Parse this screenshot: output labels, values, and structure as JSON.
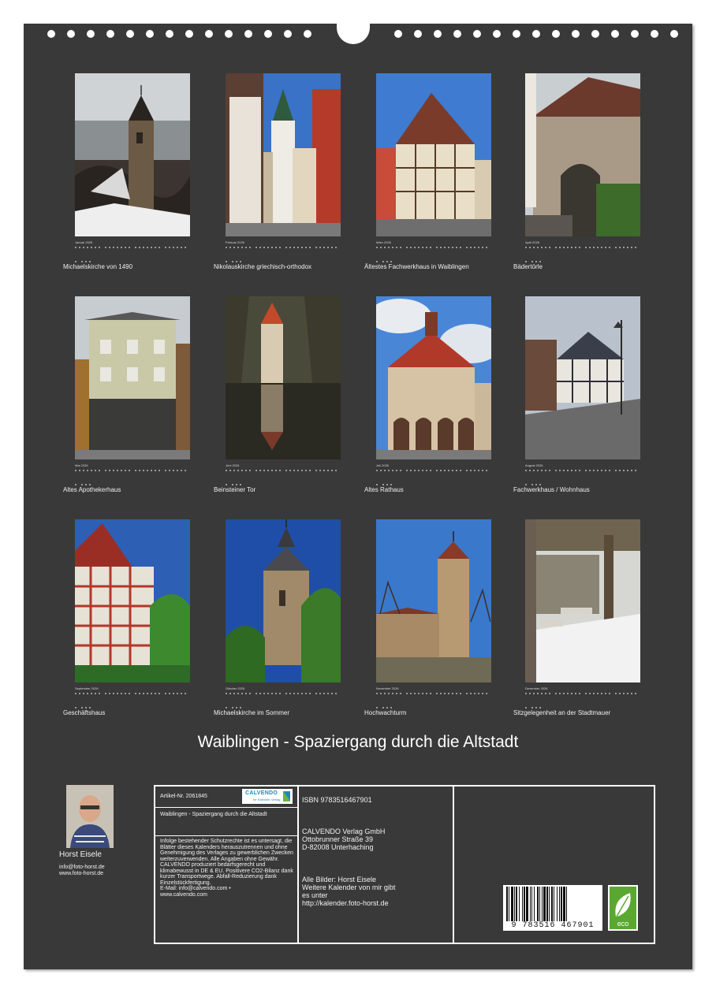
{
  "months": [
    {
      "month": "Januar 2026",
      "caption": "Michaelskirche von 1490"
    },
    {
      "month": "Februar 2026",
      "caption": "Nikolauskirche griechisch-orthodox"
    },
    {
      "month": "März 2026",
      "caption": "Ältestes Fachwerkhaus in Waiblingen"
    },
    {
      "month": "April 2026",
      "caption": "Bädertörle"
    },
    {
      "month": "Mai 2026",
      "caption": "Altes Apothekerhaus"
    },
    {
      "month": "Juni 2026",
      "caption": "Beinsteiner Tor"
    },
    {
      "month": "Juli 2026",
      "caption": "Altes Rathaus"
    },
    {
      "month": "August 2026",
      "caption": "Fachwerkhaus / Wohnhaus"
    },
    {
      "month": "September 2026",
      "caption": "Geschäftshaus"
    },
    {
      "month": "Oktober 2026",
      "caption": "Michaelskirche im Sommer"
    },
    {
      "month": "November 2026",
      "caption": "Hochwachturm"
    },
    {
      "month": "Dezember 2026",
      "caption": "Sitzgelegenheit an der Stadtmauer"
    }
  ],
  "title": "Waiblingen - Spaziergang durch die Altstadt",
  "author": {
    "name": "Horst Eisele",
    "email": "info@foto-horst.de",
    "web": "www.foto-horst.de"
  },
  "info": {
    "article": "Artikel-Nr. 2061845",
    "logo": "CALVENDO",
    "logo_sub": "Ihr Kalender-Verlag",
    "product_title": "Waiblingen - Spaziergang durch die Altstadt",
    "legal_1": "Infolge bestehender Schutzrechte ist es untersagt, die Blätter dieses Kalenders herauszutrennen und ohne Genehmigung des Verlages zu gewerblichen Zwecken weiterzuverwenden. Alle Angaben ohne Gewähr.",
    "legal_2": "CALVENDO produziert bedarfsgerecht und klimabewusst in DE & EU. Positivere CO2-Bilanz dank kurzer Transportwege. Abfall-Reduzierung dank Einzelstückfertigung.",
    "legal_3": "E-Mail: info@calvendo.com •",
    "legal_4": "www.calvendo.com",
    "isbn": "ISBN 9783516467901",
    "publisher_1": "CALVENDO Verlag GmbH",
    "publisher_2": "Ottobrunner Straße 39",
    "publisher_3": "D-82008 Unterhaching",
    "images_1": "Alle Bilder: Horst Eisele",
    "images_2": "Weitere Kalender von mir gibt",
    "images_3": "es unter",
    "images_4": "http://kalender.foto-horst.de",
    "barcode_number": "9 783516 467901",
    "eco_label": "eco"
  },
  "colors": {
    "background": "#393939",
    "text": "#f0f0f0",
    "logo_blue": "#1c8ab8",
    "eco_green": "#5aa832"
  }
}
